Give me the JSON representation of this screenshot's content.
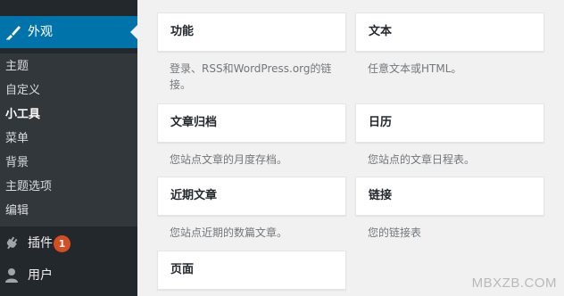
{
  "sidebar": {
    "appearance": {
      "label": "外观",
      "icon": "paintbrush-icon",
      "active_color": "#0073aa"
    },
    "submenu": [
      {
        "label": "主题"
      },
      {
        "label": "自定义"
      },
      {
        "label": "小工具",
        "current": true
      },
      {
        "label": "菜单"
      },
      {
        "label": "背景"
      },
      {
        "label": "主题选项"
      },
      {
        "label": "编辑"
      }
    ],
    "plugins": {
      "label": "插件",
      "icon": "plug-icon",
      "badge": "1"
    },
    "users": {
      "label": "用户",
      "icon": "user-icon"
    }
  },
  "widgets": [
    {
      "title": "功能",
      "description": "登录、RSS和WordPress.org的链接。"
    },
    {
      "title": "文本",
      "description": "任意文本或HTML。"
    },
    {
      "title": "文章归档",
      "description": "您站点文章的月度存档。"
    },
    {
      "title": "日历",
      "description": "您站点的文章日程表。"
    },
    {
      "title": "近期文章",
      "description": "您站点近期的数篇文章。"
    },
    {
      "title": "链接",
      "description": "您的链接表"
    },
    {
      "title": "页面",
      "description": ""
    }
  ],
  "watermark": "MBXZB.COM",
  "colors": {
    "sidebar_bg": "#23282d",
    "submenu_bg": "#32373c",
    "accent": "#0073aa",
    "badge": "#d54e21",
    "page_bg": "#f1f1f1"
  }
}
